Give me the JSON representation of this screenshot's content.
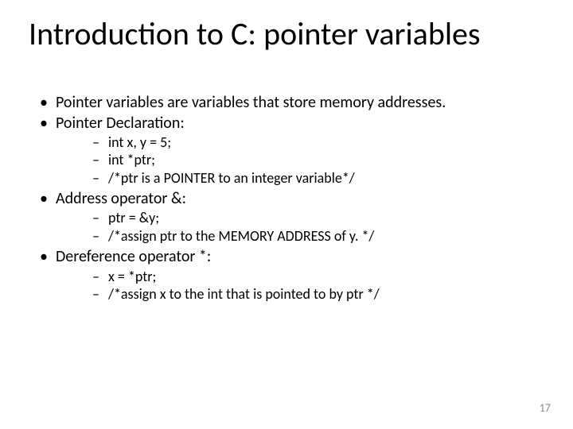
{
  "title": "Introduction to C: pointer variables",
  "bullets": {
    "b0": "Pointer variables are variables that store memory addresses.",
    "b1": "Pointer Declaration:",
    "b1s": {
      "s0": "int x, y = 5;",
      "s1": "int *ptr;",
      "s2": "/*ptr is a POINTER to an integer variable*/"
    },
    "b2": "Address operator &:",
    "b2s": {
      "s0": "ptr = &y;",
      "s1": "/*assign ptr to the MEMORY ADDRESS of y. */"
    },
    "b3": "Dereference operator *:",
    "b3s": {
      "s0": "x = *ptr;",
      "s1": "/*assign x to the int that is pointed to by ptr */"
    }
  },
  "page_number": "17"
}
